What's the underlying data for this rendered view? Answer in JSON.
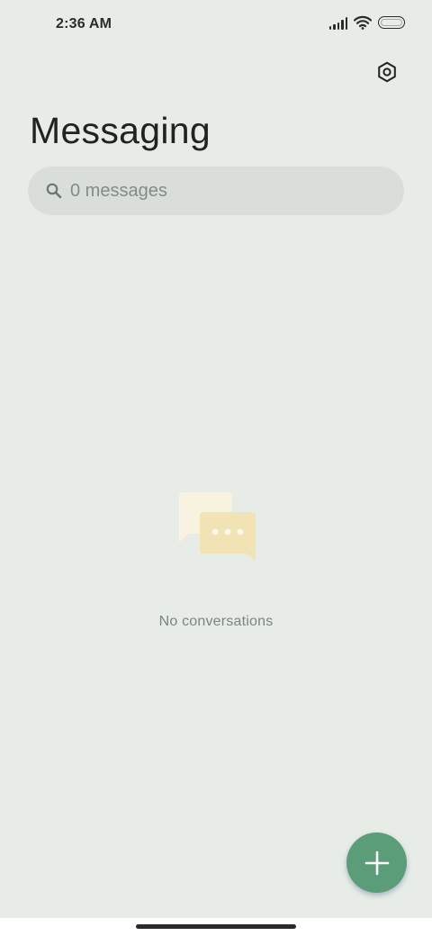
{
  "status_bar": {
    "time": "2:36 AM",
    "icons": [
      "signal-icon",
      "wifi-icon",
      "battery-icon"
    ]
  },
  "header": {
    "title": "Messaging",
    "settings_icon": "settings-hexagon-icon"
  },
  "search": {
    "placeholder": "0 messages",
    "value": "",
    "icon": "search-icon"
  },
  "empty_state": {
    "icon": "chat-bubbles-icon",
    "text": "No conversations"
  },
  "fab": {
    "icon": "plus-icon",
    "color": "#5b9d78"
  },
  "colors": {
    "background": "#e7ece6",
    "search_background": "#d9dfd8",
    "accent": "#5b9d78"
  }
}
